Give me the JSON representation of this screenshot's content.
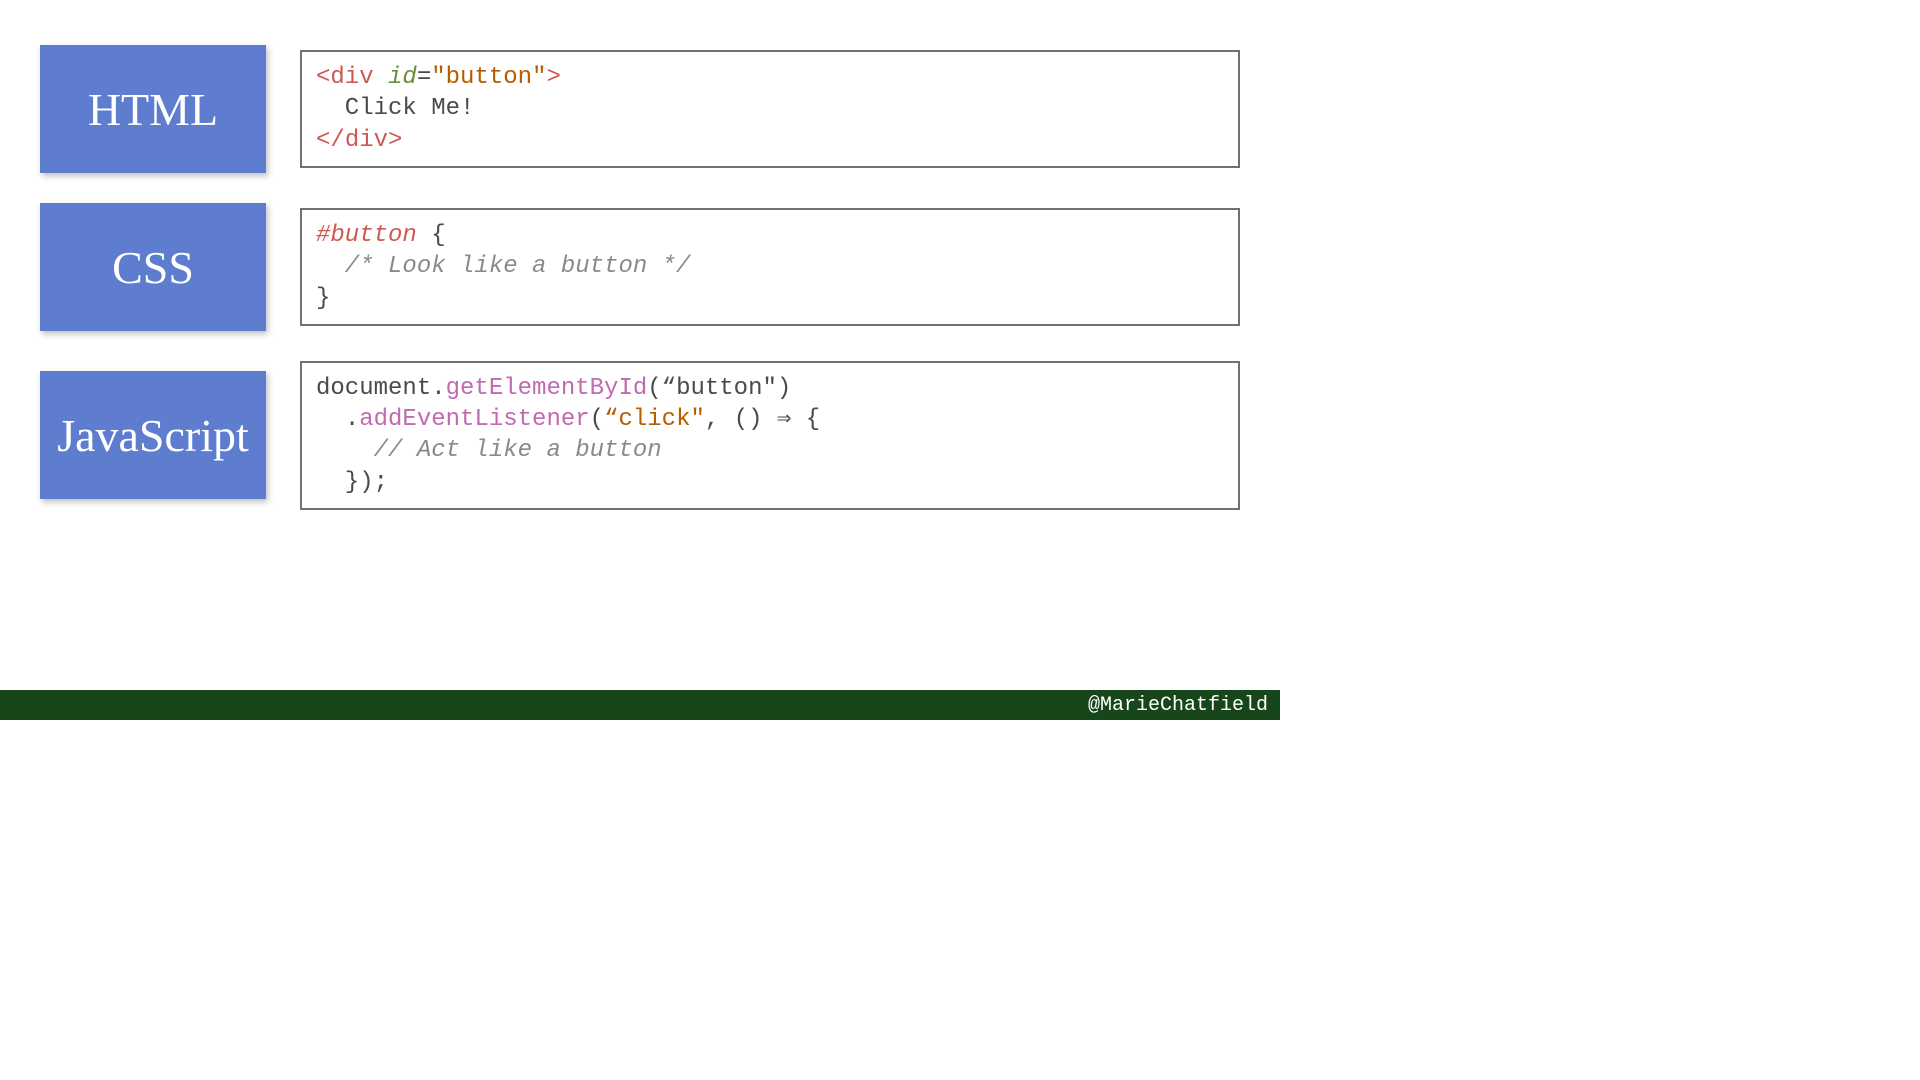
{
  "labels": {
    "html": "HTML",
    "css": "CSS",
    "js": "JavaScript"
  },
  "html_code": {
    "open_bracket": "<",
    "tag": "div",
    "attr": "id",
    "equals": "=",
    "value": "\"button\"",
    "close_bracket": ">",
    "content": "  Click Me!",
    "close_open": "</",
    "close_tag": "div",
    "close_close": ">"
  },
  "css_code": {
    "selector": "#button",
    "brace_open": " {",
    "comment": "  /* Look like a button */",
    "brace_close": "}"
  },
  "js_code": {
    "object": "document",
    "dot1": ".",
    "method1": "getElementById",
    "call1": "(“button\")",
    "indent1": "  ",
    "dot2": ".",
    "method2": "addEventListener",
    "call2_open": "(",
    "arg1": "“click\"",
    "comma": ", ",
    "arrow_params": "()",
    "arrow": " ⇒ ",
    "brace_open": "{",
    "comment": "    // Act like a button",
    "close": "  });"
  },
  "footer": "@MarieChatfield"
}
